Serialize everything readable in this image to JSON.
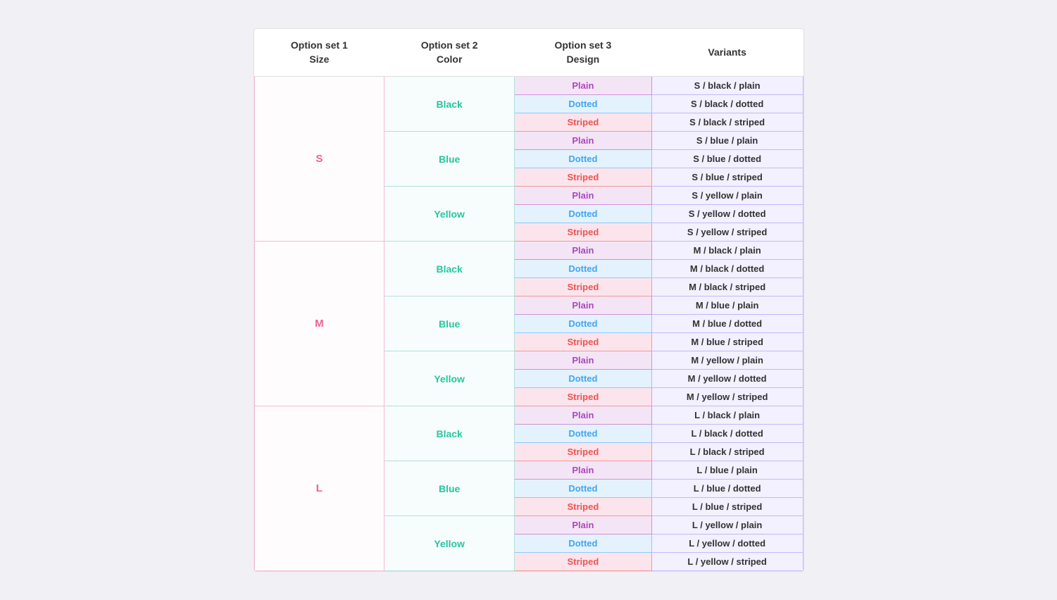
{
  "table": {
    "headers": [
      {
        "line1": "Option set 1",
        "line2": "Size"
      },
      {
        "line1": "Option set 2",
        "line2": "Color"
      },
      {
        "line1": "Option set 3",
        "line2": "Design"
      },
      {
        "line1": "Variants",
        "line2": ""
      }
    ],
    "sizes": [
      {
        "size": "S",
        "colors": [
          {
            "color": "Black",
            "designs": [
              {
                "design": "Plain",
                "variant": "S / black / plain"
              },
              {
                "design": "Dotted",
                "variant": "S / black / dotted"
              },
              {
                "design": "Striped",
                "variant": "S / black / striped"
              }
            ]
          },
          {
            "color": "Blue",
            "designs": [
              {
                "design": "Plain",
                "variant": "S / blue / plain"
              },
              {
                "design": "Dotted",
                "variant": "S / blue / dotted"
              },
              {
                "design": "Striped",
                "variant": "S / blue / striped"
              }
            ]
          },
          {
            "color": "Yellow",
            "designs": [
              {
                "design": "Plain",
                "variant": "S / yellow / plain"
              },
              {
                "design": "Dotted",
                "variant": "S / yellow / dotted"
              },
              {
                "design": "Striped",
                "variant": "S / yellow / striped"
              }
            ]
          }
        ]
      },
      {
        "size": "M",
        "colors": [
          {
            "color": "Black",
            "designs": [
              {
                "design": "Plain",
                "variant": "M / black / plain"
              },
              {
                "design": "Dotted",
                "variant": "M / black / dotted"
              },
              {
                "design": "Striped",
                "variant": "M / black / striped"
              }
            ]
          },
          {
            "color": "Blue",
            "designs": [
              {
                "design": "Plain",
                "variant": "M / blue / plain"
              },
              {
                "design": "Dotted",
                "variant": "M / blue / dotted"
              },
              {
                "design": "Striped",
                "variant": "M / blue / striped"
              }
            ]
          },
          {
            "color": "Yellow",
            "designs": [
              {
                "design": "Plain",
                "variant": "M / yellow / plain"
              },
              {
                "design": "Dotted",
                "variant": "M / yellow / dotted"
              },
              {
                "design": "Striped",
                "variant": "M / yellow / striped"
              }
            ]
          }
        ]
      },
      {
        "size": "L",
        "colors": [
          {
            "color": "Black",
            "designs": [
              {
                "design": "Plain",
                "variant": "L / black / plain"
              },
              {
                "design": "Dotted",
                "variant": "L / black / dotted"
              },
              {
                "design": "Striped",
                "variant": "L / black / striped"
              }
            ]
          },
          {
            "color": "Blue",
            "designs": [
              {
                "design": "Plain",
                "variant": "L / blue / plain"
              },
              {
                "design": "Dotted",
                "variant": "L / blue / dotted"
              },
              {
                "design": "Striped",
                "variant": "L / blue / striped"
              }
            ]
          },
          {
            "color": "Yellow",
            "designs": [
              {
                "design": "Plain",
                "variant": "L / yellow / plain"
              },
              {
                "design": "Dotted",
                "variant": "L / yellow / dotted"
              },
              {
                "design": "Striped",
                "variant": "L / yellow / striped"
              }
            ]
          }
        ]
      }
    ]
  }
}
